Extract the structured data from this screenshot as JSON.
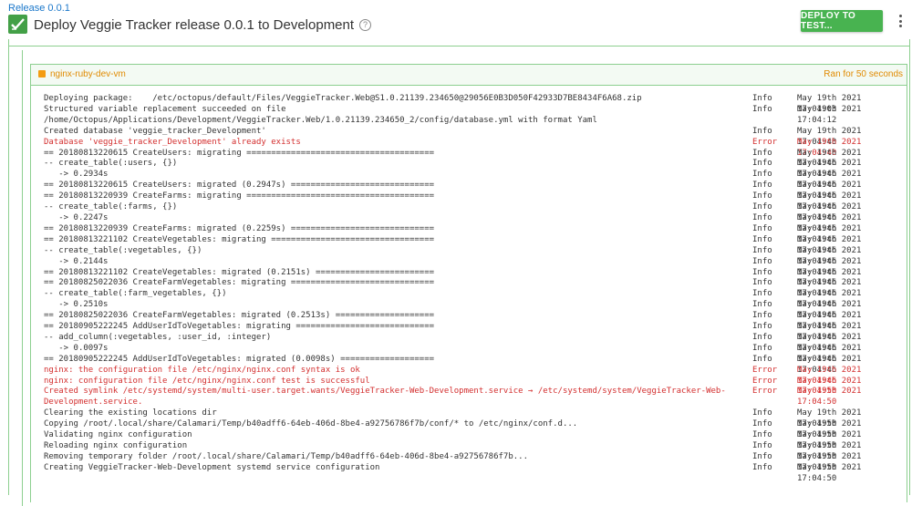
{
  "header": {
    "breadcrumb": "Release 0.0.1",
    "title": "Deploy Veggie Tracker release 0.0.1 to Development",
    "help_glyph": "?",
    "deploy_button": "DEPLOY TO TEST...",
    "status_icon": "check-icon",
    "menu_icon": "more-vert-icon"
  },
  "colors": {
    "success_green": "#43a047",
    "button_green": "#48b350",
    "frame_green": "#8ccf8f",
    "target_orange": "#e08a00",
    "error_red": "#d32f2f",
    "link_blue": "#1a77ca"
  },
  "target": {
    "name": "nginx-ruby-dev-vm",
    "duration": "Ran for 50 seconds",
    "status_icon": "minus-square-icon"
  },
  "log": [
    {
      "message": "Deploying package:    /etc/octopus/default/Files/VeggieTracker.Web@S1.0.21139.234650@29056E0B3D050F42933D7BE8434F6A68.zip",
      "level": "Info",
      "time": "May 19th 2021 17:04:03",
      "error": false
    },
    {
      "message": "Structured variable replacement succeeded on file /home/Octopus/Applications/Development/VeggieTracker.Web/1.0.21139.234650_2/config/database.yml with format Yaml",
      "level": "Info",
      "time": "May 19th 2021 17:04:12",
      "error": false
    },
    {
      "message": "Created database 'veggie_tracker_Development'",
      "level": "Info",
      "time": "May 19th 2021 17:04:40",
      "error": false
    },
    {
      "message": "Database 'veggie_tracker_Development' already exists",
      "level": "Error",
      "time": "May 19th 2021 17:04:40",
      "error": true
    },
    {
      "message": "== 20180813220615 CreateUsers: migrating ======================================",
      "level": "Info",
      "time": "May 19th 2021 17:04:46",
      "error": false
    },
    {
      "message": "-- create_table(:users, {})",
      "level": "Info",
      "time": "May 19th 2021 17:04:46",
      "error": false
    },
    {
      "message": "   -> 0.2934s",
      "level": "Info",
      "time": "May 19th 2021 17:04:46",
      "error": false
    },
    {
      "message": "== 20180813220615 CreateUsers: migrated (0.2947s) =============================",
      "level": "Info",
      "time": "May 19th 2021 17:04:46",
      "error": false
    },
    {
      "message": "== 20180813220939 CreateFarms: migrating ======================================",
      "level": "Info",
      "time": "May 19th 2021 17:04:46",
      "error": false
    },
    {
      "message": "-- create_table(:farms, {})",
      "level": "Info",
      "time": "May 19th 2021 17:04:46",
      "error": false
    },
    {
      "message": "   -> 0.2247s",
      "level": "Info",
      "time": "May 19th 2021 17:04:46",
      "error": false
    },
    {
      "message": "== 20180813220939 CreateFarms: migrated (0.2259s) =============================",
      "level": "Info",
      "time": "May 19th 2021 17:04:46",
      "error": false
    },
    {
      "message": "== 20180813221102 CreateVegetables: migrating =================================",
      "level": "Info",
      "time": "May 19th 2021 17:04:46",
      "error": false
    },
    {
      "message": "-- create_table(:vegetables, {})",
      "level": "Info",
      "time": "May 19th 2021 17:04:46",
      "error": false
    },
    {
      "message": "   -> 0.2144s",
      "level": "Info",
      "time": "May 19th 2021 17:04:46",
      "error": false
    },
    {
      "message": "== 20180813221102 CreateVegetables: migrated (0.2151s) ========================",
      "level": "Info",
      "time": "May 19th 2021 17:04:46",
      "error": false
    },
    {
      "message": "== 20180825022036 CreateFarmVegetables: migrating =============================",
      "level": "Info",
      "time": "May 19th 2021 17:04:46",
      "error": false
    },
    {
      "message": "-- create_table(:farm_vegetables, {})",
      "level": "Info",
      "time": "May 19th 2021 17:04:46",
      "error": false
    },
    {
      "message": "   -> 0.2510s",
      "level": "Info",
      "time": "May 19th 2021 17:04:46",
      "error": false
    },
    {
      "message": "== 20180825022036 CreateFarmVegetables: migrated (0.2513s) ====================",
      "level": "Info",
      "time": "May 19th 2021 17:04:46",
      "error": false
    },
    {
      "message": "== 20180905222245 AddUserIdToVegetables: migrating ============================",
      "level": "Info",
      "time": "May 19th 2021 17:04:46",
      "error": false
    },
    {
      "message": "-- add_column(:vegetables, :user_id, :integer)",
      "level": "Info",
      "time": "May 19th 2021 17:04:46",
      "error": false
    },
    {
      "message": "   -> 0.0097s",
      "level": "Info",
      "time": "May 19th 2021 17:04:46",
      "error": false
    },
    {
      "message": "== 20180905222245 AddUserIdToVegetables: migrated (0.0098s) ===================",
      "level": "Info",
      "time": "May 19th 2021 17:04:46",
      "error": false
    },
    {
      "message": "nginx: the configuration file /etc/nginx/nginx.conf syntax is ok",
      "level": "Error",
      "time": "May 19th 2021 17:04:46",
      "error": true
    },
    {
      "message": "nginx: configuration file /etc/nginx/nginx.conf test is successful",
      "level": "Error",
      "time": "May 19th 2021 17:04:50",
      "error": true
    },
    {
      "message": "Created symlink /etc/systemd/system/multi-user.target.wants/VeggieTracker-Web-Development.service → /etc/systemd/system/VeggieTracker-Web-Development.service.",
      "level": "Error",
      "time": "May 19th 2021 17:04:50",
      "error": true
    },
    {
      "message": "Clearing the existing locations dir",
      "level": "Info",
      "time": "May 19th 2021 17:04:50",
      "error": false
    },
    {
      "message": "Copying /root/.local/share/Calamari/Temp/b40adff6-64eb-406d-8be4-a92756786f7b/conf/* to /etc/nginx/conf.d...",
      "level": "Info",
      "time": "May 19th 2021 17:04:50",
      "error": false
    },
    {
      "message": "Validating nginx configuration",
      "level": "Info",
      "time": "May 19th 2021 17:04:50",
      "error": false
    },
    {
      "message": "Reloading nginx configuration",
      "level": "Info",
      "time": "May 19th 2021 17:04:50",
      "error": false
    },
    {
      "message": "Removing temporary folder /root/.local/share/Calamari/Temp/b40adff6-64eb-406d-8be4-a92756786f7b...",
      "level": "Info",
      "time": "May 19th 2021 17:04:50",
      "error": false
    },
    {
      "message": "Creating VeggieTracker-Web-Development systemd service configuration",
      "level": "Info",
      "time": "May 19th 2021 17:04:50",
      "error": false
    }
  ]
}
